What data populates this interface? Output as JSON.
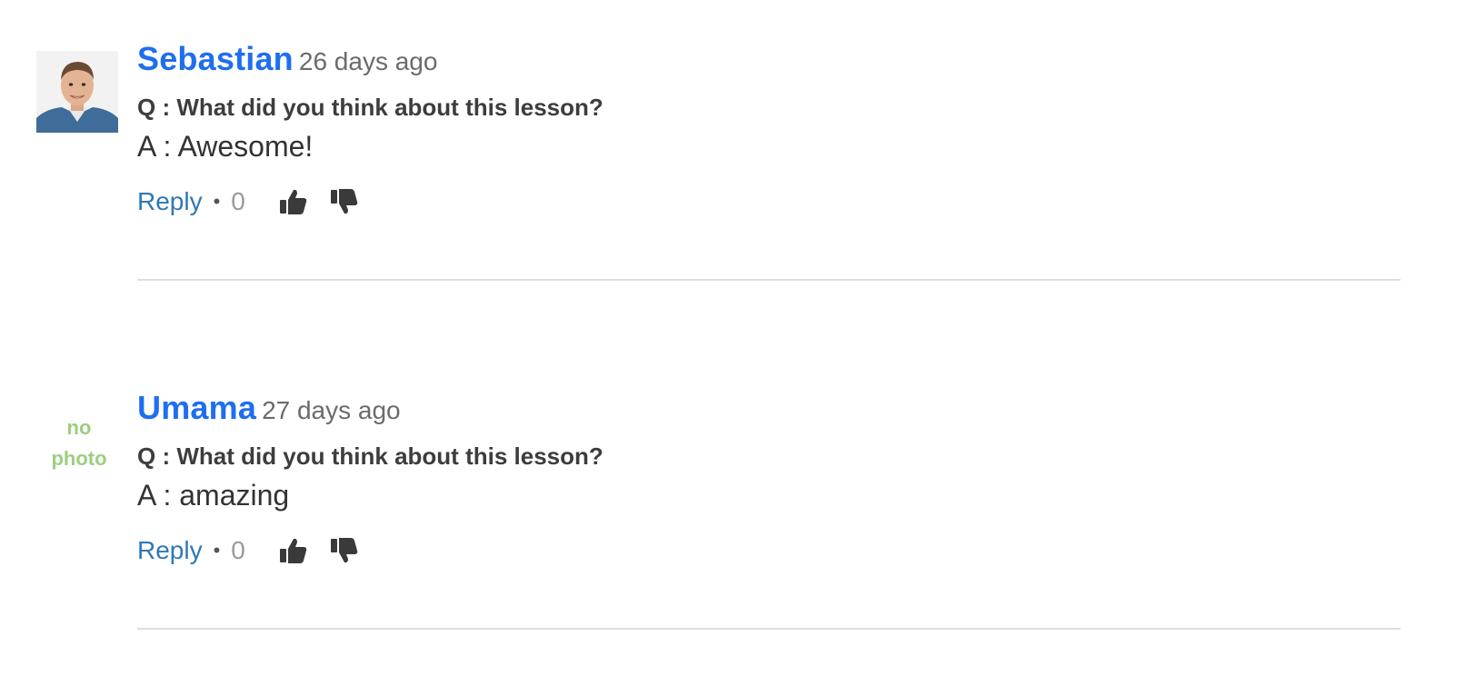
{
  "comments": [
    {
      "author": "Sebastian",
      "time": "26 days ago",
      "question": "Q : What did you think about this lesson?",
      "answer": "A : Awesome!",
      "reply_label": "Reply",
      "bullet": "•",
      "vote_count": "0",
      "has_photo": true
    },
    {
      "author": "Umama",
      "time": "27 days ago",
      "question": "Q : What did you think about this lesson?",
      "answer": "A : amazing",
      "reply_label": "Reply",
      "bullet": "•",
      "vote_count": "0",
      "has_photo": false,
      "no_photo_label": "no photo"
    }
  ],
  "colors": {
    "author": "#1f6ef0",
    "reply": "#2f78b5",
    "no_photo": "#9ccf80",
    "icon": "#3a3a3a",
    "divider": "#dedede"
  },
  "icons": {
    "upvote": "thumbs-up-icon",
    "downvote": "thumbs-down-icon"
  }
}
